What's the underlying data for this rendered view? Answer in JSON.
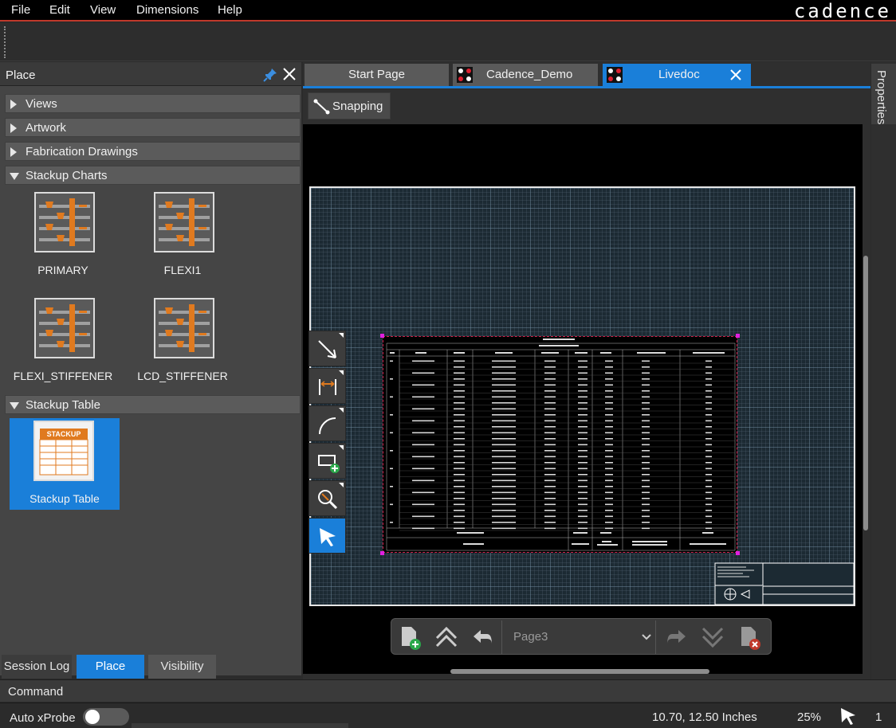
{
  "menu": [
    "File",
    "Edit",
    "View",
    "Dimensions",
    "Help"
  ],
  "brand": "cadence",
  "place_panel": {
    "title": "Place",
    "sections": [
      {
        "label": "Views",
        "expanded": false
      },
      {
        "label": "Artwork",
        "expanded": false
      },
      {
        "label": "Fabrication Drawings",
        "expanded": false
      },
      {
        "label": "Stackup Charts",
        "expanded": true
      },
      {
        "label": "Stackup Table",
        "expanded": true
      }
    ],
    "charts": [
      {
        "label": "PRIMARY"
      },
      {
        "label": "FLEXI1"
      },
      {
        "label": "FLEXI_STIFFENER"
      },
      {
        "label": "LCD_STIFFENER"
      }
    ],
    "table_tile": {
      "label": "Stackup Table",
      "thumb_text": "STACKUP"
    }
  },
  "bottom_tabs": [
    {
      "label": "Session Log",
      "active": false
    },
    {
      "label": "Place",
      "active": true
    },
    {
      "label": "Visibility",
      "active": false
    }
  ],
  "doc_tabs": [
    {
      "label": "Start Page",
      "active": false
    },
    {
      "label": "Cadence_Demo",
      "active": false
    },
    {
      "label": "Livedoc",
      "active": true
    }
  ],
  "toolbar": {
    "snapping_label": "Snapping"
  },
  "page_nav": {
    "current_page": "Page3"
  },
  "properties_label": "Properties",
  "command_label": "Command",
  "status": {
    "auto_xprobe_label": "Auto xProbe",
    "coordinates": "10.70, 12.50 Inches",
    "zoom": "25%",
    "selection_count": "1"
  },
  "colors": {
    "accent": "#1a7fd9",
    "menu_underline": "#c0392b",
    "table_border": "#d0204a"
  }
}
